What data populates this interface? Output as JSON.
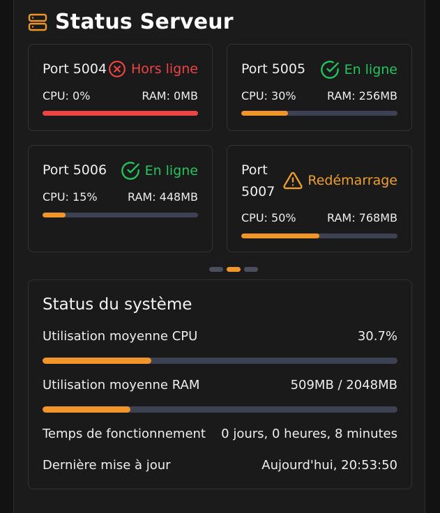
{
  "header": {
    "title": "Status Serveur",
    "icon": "server-icon",
    "accent": "#f0952a"
  },
  "servers": [
    {
      "port": "Port 5004",
      "status": "Hors ligne",
      "status_icon": "x-circle-icon",
      "status_color": "#ef4444",
      "cpu": "CPU: 0%",
      "ram": "RAM: 0MB",
      "load": 1.0,
      "bar_color": "#ef4444"
    },
    {
      "port": "Port 5005",
      "status": "En ligne",
      "status_icon": "check-circle-icon",
      "status_color": "#22c55e",
      "cpu": "CPU: 30%",
      "ram": "RAM: 256MB",
      "load": 0.3,
      "bar_color": "#f0952a"
    },
    {
      "port": "Port 5006",
      "status": "En ligne",
      "status_icon": "check-circle-icon",
      "status_color": "#22c55e",
      "cpu": "CPU: 15%",
      "ram": "RAM: 448MB",
      "load": 0.15,
      "bar_color": "#f0952a"
    },
    {
      "port": "Port 5007",
      "status": "Redémarrage",
      "status_icon": "warning-triangle-icon",
      "status_color": "#f0a02a",
      "cpu": "CPU: 50%",
      "ram": "RAM: 768MB",
      "load": 0.5,
      "bar_color": "#f0952a"
    }
  ],
  "pagination": {
    "count": 3,
    "active": 1
  },
  "system": {
    "title": "Status du système",
    "cpu_label": "Utilisation moyenne CPU",
    "cpu_value": "30.7%",
    "cpu_load": 0.307,
    "ram_label": "Utilisation moyenne RAM",
    "ram_value": "509MB / 2048MB",
    "ram_load": 0.2485,
    "uptime_label": "Temps de fonctionnement",
    "uptime_value": "0 jours, 0 heures, 8 minutes",
    "updated_label": "Dernière mise à jour",
    "updated_value": "Aujourd'hui, 20:53:50",
    "bar_color": "#f0952a"
  }
}
